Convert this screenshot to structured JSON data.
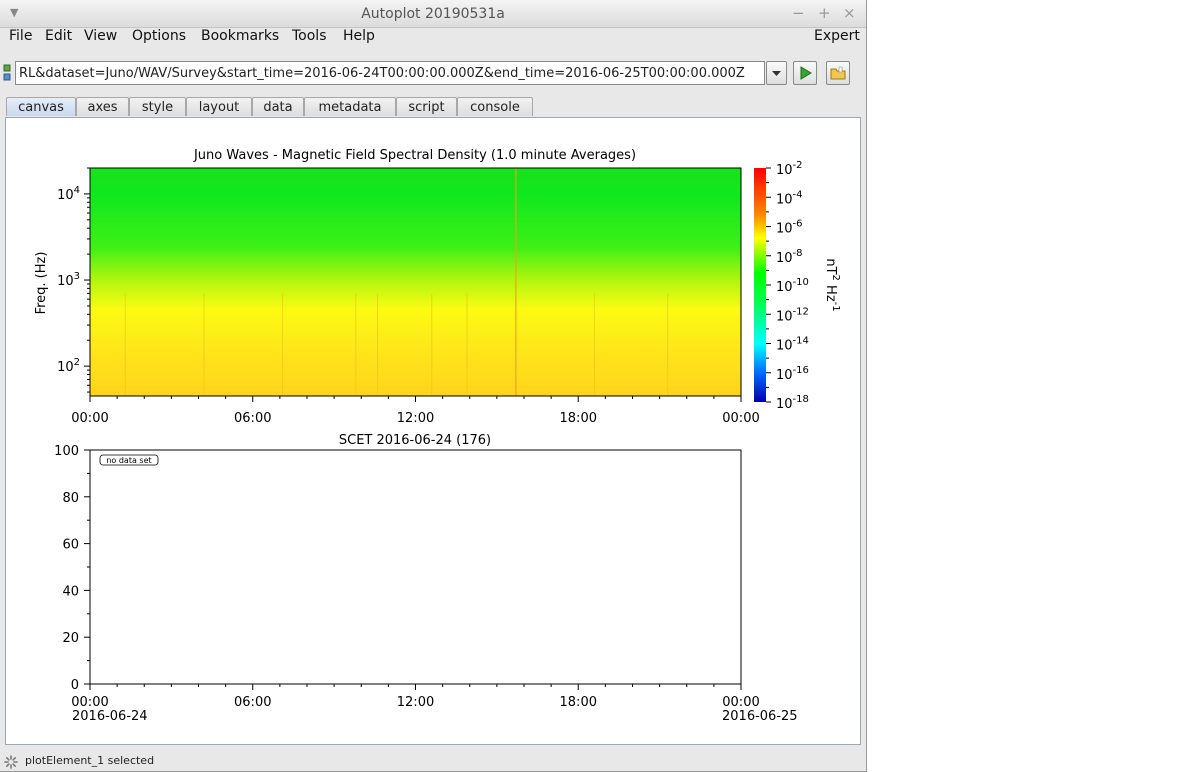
{
  "window": {
    "title": "Autoplot 20190531a"
  },
  "menubar": {
    "items": [
      "File",
      "Edit",
      "View",
      "Options",
      "Bookmarks",
      "Tools",
      "Help"
    ],
    "expert": "Expert"
  },
  "url_field": {
    "value": "RL&dataset=Juno/WAV/Survey&start_time=2016-06-24T00:00:00.000Z&end_time=2016-06-25T00:00:00.000Z"
  },
  "tabs": [
    "canvas",
    "axes",
    "style",
    "layout",
    "data",
    "metadata",
    "script",
    "console"
  ],
  "active_tab": "canvas",
  "status": {
    "text": "plotElement_1 selected"
  },
  "colors": {
    "accent": "#3b6fb6"
  },
  "chart_data": [
    {
      "type": "heatmap",
      "title": "Juno Waves - Magnetic Field Spectral Density (1.0 minute Averages)",
      "ylabel": "Freq. (Hz)",
      "y_scale": "log",
      "ylim": [
        45,
        20000
      ],
      "y_ticks": [
        {
          "value": 100,
          "base": "10",
          "exp": "2"
        },
        {
          "value": 1000,
          "base": "10",
          "exp": "3"
        },
        {
          "value": 10000,
          "base": "10",
          "exp": "4"
        }
      ],
      "x_ticks": [
        "00:00",
        "06:00",
        "12:00",
        "18:00",
        "00:00"
      ],
      "xlim_hours": [
        0,
        24
      ],
      "colorbar": {
        "label_base": "nT",
        "label_exp1": "2",
        "label_mid": " Hz",
        "label_exp2": "-1",
        "scale": "log",
        "ticks": [
          {
            "base": "10",
            "exp": "-2"
          },
          {
            "base": "10",
            "exp": "-4"
          },
          {
            "base": "10",
            "exp": "-6"
          },
          {
            "base": "10",
            "exp": "-8"
          },
          {
            "base": "10",
            "exp": "-10"
          },
          {
            "base": "10",
            "exp": "-12"
          },
          {
            "base": "10",
            "exp": "-14"
          },
          {
            "base": "10",
            "exp": "-16"
          },
          {
            "base": "10",
            "exp": "-18"
          }
        ]
      },
      "x_caption": "SCET 2016-06-24 (176)"
    },
    {
      "type": "line",
      "annotation": "no data set",
      "ylim": [
        0,
        100
      ],
      "y_ticks": [
        "0",
        "20",
        "40",
        "60",
        "80",
        "100"
      ],
      "x_ticks": [
        "00:00",
        "06:00",
        "12:00",
        "18:00",
        "00:00"
      ],
      "date_start": "2016-06-24",
      "date_end": "2016-06-25",
      "grid": false
    }
  ]
}
